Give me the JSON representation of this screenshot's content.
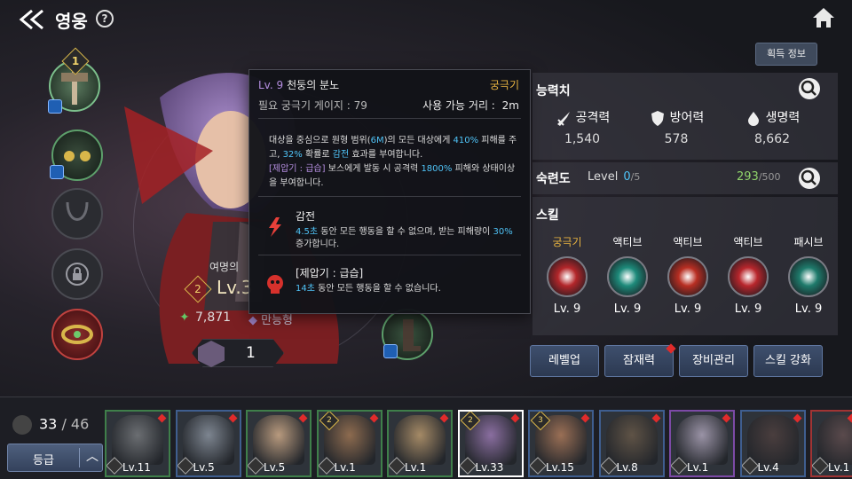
{
  "header": {
    "title": "영웅",
    "help": "?"
  },
  "hero": {
    "alias": "여명의",
    "rank": "2",
    "level": "Lv.3",
    "power": "7,871",
    "class_name": "만능형",
    "count": "1",
    "weapon_level": "1"
  },
  "tooltip": {
    "skill_level": "Lv. 9",
    "skill_name": "천둥의 분노",
    "skill_type": "궁극기",
    "gauge": "필요 궁극기 게이지 : 79",
    "range_label": "사용 가능 거리 :",
    "range_value": "2m",
    "desc": {
      "p1": "대상을 중심으로 원형 범위(",
      "r": "6M",
      "p2": ")의 모든 대상에게 ",
      "pct1": "410%",
      "p3": " 피해를 주고, ",
      "pct2": "32%",
      "p4": " 확률로 ",
      "eff": "감전",
      "p5": " 효과를 부여합니다.",
      "bracket": "[제압기 : 급습]",
      "p6": " 보스에게 발동 시 공격력 ",
      "pct3": "1800%",
      "p7": " 피해와 상태이상을 부여합니다."
    },
    "effects": [
      {
        "name": "감전",
        "a": "4.5초",
        "b": " 동안 모든 행동을 할 수 없으며, 받는 피해량이 ",
        "c": "30%",
        "d": " 증가합니다."
      },
      {
        "name": "[제압기 : 급습]",
        "a": "14초",
        "b": " 동안 모든 행동을 할 수 없습니다.",
        "c": "",
        "d": ""
      }
    ]
  },
  "acquire_button": "획득 정보",
  "ability": {
    "title": "능력치",
    "stats": [
      {
        "label": "공격력",
        "value": "1,540"
      },
      {
        "label": "방어력",
        "value": "578"
      },
      {
        "label": "생명력",
        "value": "8,662"
      }
    ]
  },
  "mastery": {
    "title": "숙련도",
    "level_label": "Level",
    "level": "0",
    "level_max": "/5",
    "points": "293",
    "points_max": "/500"
  },
  "skills": {
    "title": "스킬",
    "items": [
      {
        "type": "궁극기",
        "level": "Lv. 9",
        "color": "#b3262a"
      },
      {
        "type": "액티브",
        "level": "Lv. 9",
        "color": "#1d8a7a"
      },
      {
        "type": "액티브",
        "level": "Lv. 9",
        "color": "#b82e22"
      },
      {
        "type": "액티브",
        "level": "Lv. 9",
        "color": "#b8262c"
      },
      {
        "type": "패시브",
        "level": "Lv. 9",
        "color": "#1e7a6b"
      }
    ]
  },
  "actions": {
    "levelup": "레벨업",
    "potential": "잠재력",
    "equipment": "장비관리",
    "skill_enhance": "스킬 강화"
  },
  "roster": {
    "count": "33",
    "max": "/ 46",
    "grade_button": "등급",
    "heroes": [
      {
        "level": "Lv.11",
        "color": "#6b6e72",
        "border": "green",
        "rank": ""
      },
      {
        "level": "Lv.5",
        "color": "#7d8590",
        "border": "blue",
        "rank": ""
      },
      {
        "level": "Lv.5",
        "color": "#b89a7e",
        "border": "green",
        "rank": ""
      },
      {
        "level": "Lv.1",
        "color": "#8d6b4f",
        "border": "green",
        "rank": "2"
      },
      {
        "level": "Lv.1",
        "color": "#a58a66",
        "border": "green",
        "rank": ""
      },
      {
        "level": "Lv.33",
        "color": "#8a6ea0",
        "border": "selected",
        "rank": "2"
      },
      {
        "level": "Lv.15",
        "color": "#9a6f55",
        "border": "blue",
        "rank": "3"
      },
      {
        "level": "Lv.8",
        "color": "#5f5346",
        "border": "blue",
        "rank": ""
      },
      {
        "level": "Lv.1",
        "color": "#9a93a6",
        "border": "purple",
        "rank": ""
      },
      {
        "level": "Lv.4",
        "color": "#4a3e3e",
        "border": "blue",
        "rank": ""
      },
      {
        "level": "Lv.1",
        "color": "#5a4a4c",
        "border": "red",
        "rank": ""
      }
    ]
  }
}
